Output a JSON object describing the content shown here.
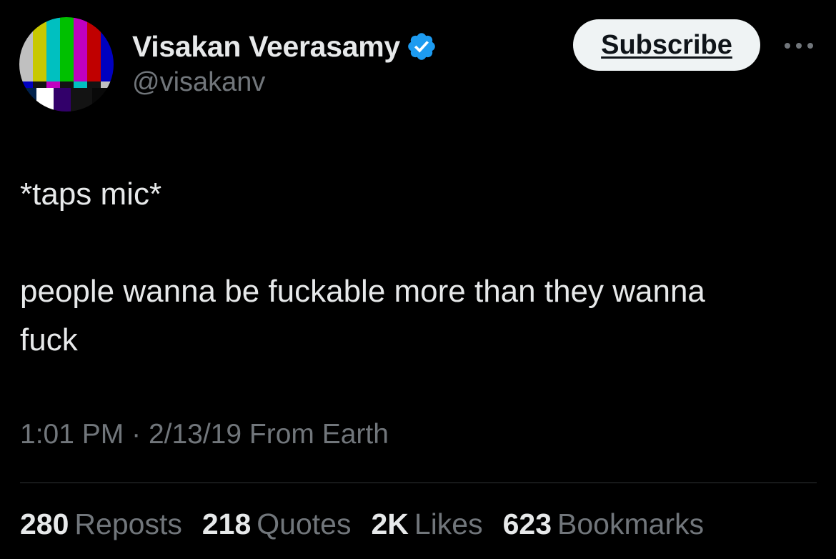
{
  "author": {
    "display_name": "Visakan Veerasamy",
    "handle": "@visakanv",
    "avatar_icon": "tv-color-bars-icon",
    "verified": true,
    "verified_color": "#1d9bf0"
  },
  "header": {
    "subscribe_label": "Subscribe",
    "more_icon": "more-horizontal-icon"
  },
  "tweet": {
    "lines": [
      "*taps mic*",
      "people wanna be fuckable more than they wanna fuck"
    ]
  },
  "meta": {
    "time": "1:01 PM",
    "separator": "·",
    "date": "2/13/19",
    "source": "From Earth"
  },
  "stats": [
    {
      "count": "280",
      "label": "Reposts"
    },
    {
      "count": "218",
      "label": "Quotes"
    },
    {
      "count": "2K",
      "label": "Likes"
    },
    {
      "count": "623",
      "label": "Bookmarks"
    }
  ],
  "colors": {
    "background": "#000000",
    "text_primary": "#e7e9ea",
    "text_secondary": "#71767b",
    "divider": "#2f3336",
    "button_bg": "#eff3f4"
  }
}
